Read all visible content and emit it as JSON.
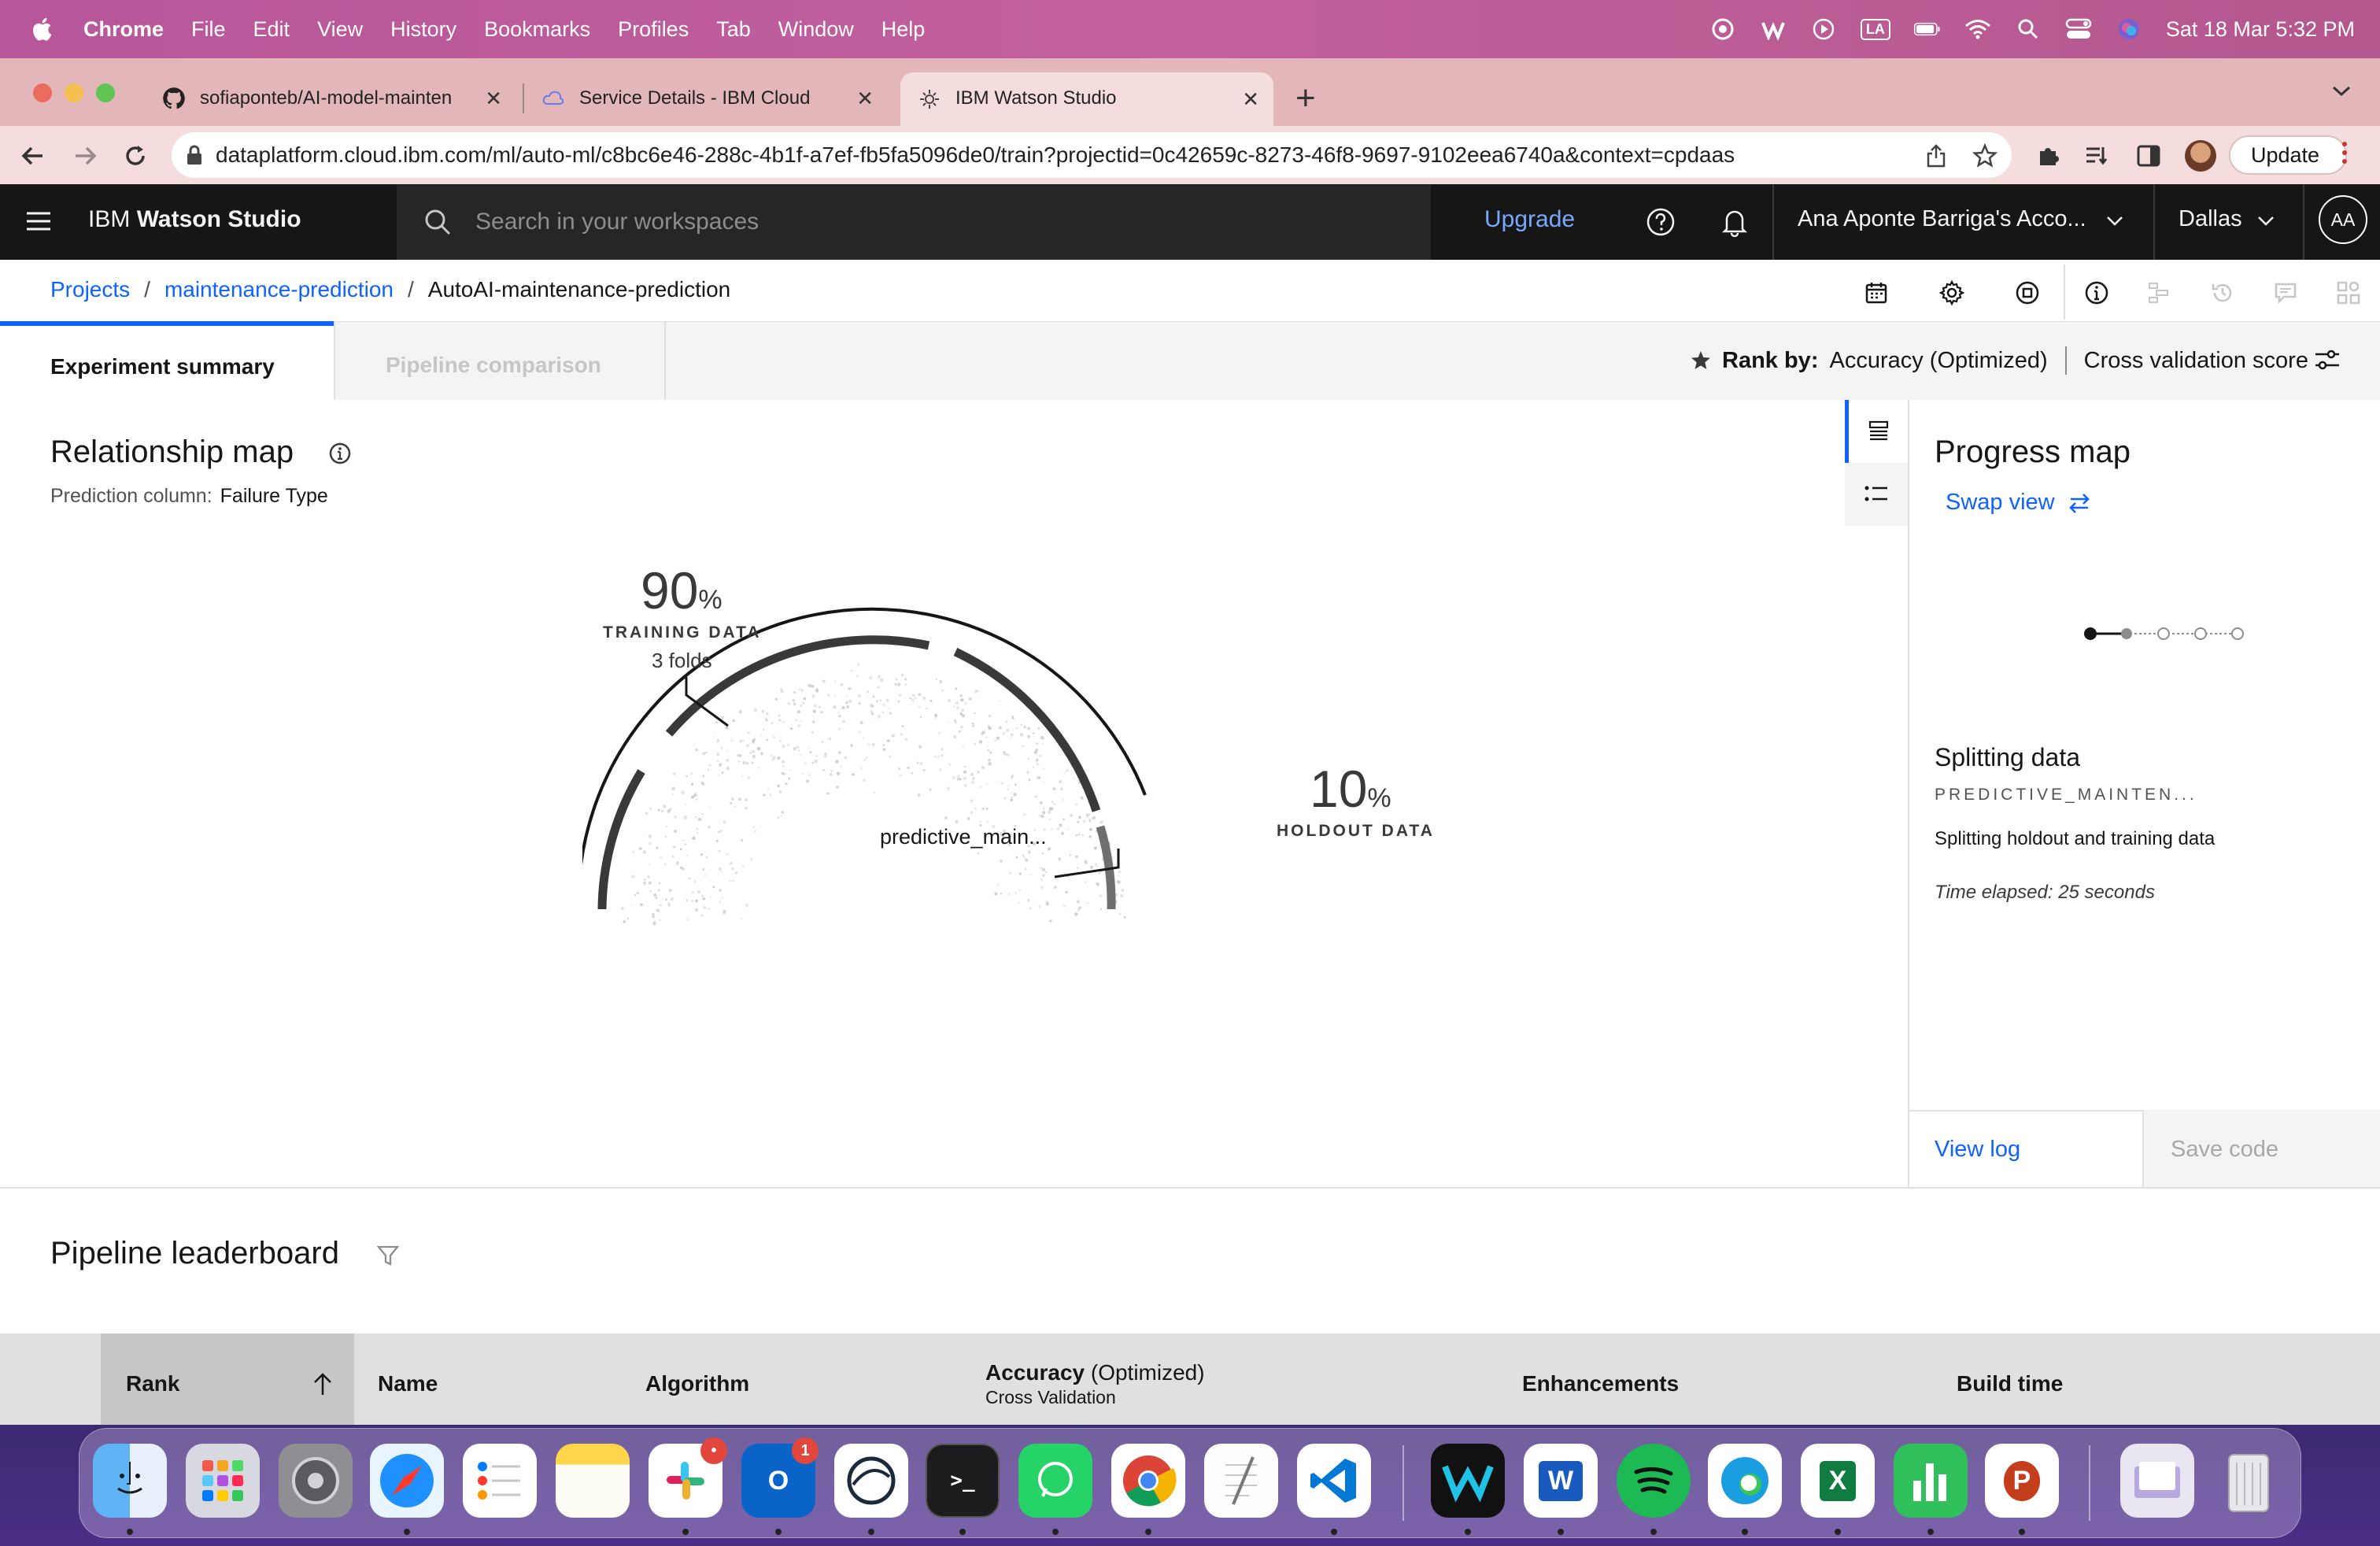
{
  "menubar": {
    "app": "Chrome",
    "items": [
      "File",
      "Edit",
      "View",
      "History",
      "Bookmarks",
      "Profiles",
      "Tab",
      "Window",
      "Help"
    ],
    "keyboard_layout": "LA",
    "datetime": "Sat 18 Mar  5:32 PM"
  },
  "browser": {
    "tabs": [
      {
        "title": "sofiaponteb/AI-model-mainten",
        "icon": "github-icon"
      },
      {
        "title": "Service Details - IBM Cloud",
        "icon": "ibm-cloud-icon"
      },
      {
        "title": "IBM Watson Studio",
        "icon": "watson-icon",
        "active": true
      }
    ],
    "url": "dataplatform.cloud.ibm.com/ml/auto-ml/c8bc6e46-288c-4b1f-a7ef-fb5fa5096de0/train?projectid=0c42659c-8273-46f8-9697-9102eea6740a&context=cpdaas",
    "update_label": "Update"
  },
  "ibm_header": {
    "brand_prefix": "IBM",
    "brand_name": "Watson Studio",
    "search_placeholder": "Search in your workspaces",
    "upgrade_label": "Upgrade",
    "account": "Ana Aponte Barriga's Acco...",
    "region": "Dallas",
    "avatar_initials": "AA"
  },
  "breadcrumb": {
    "projects": "Projects",
    "project": "maintenance-prediction",
    "experiment": "AutoAI-maintenance-prediction",
    "separator": "/"
  },
  "tabs": {
    "summary": "Experiment summary",
    "comparison": "Pipeline comparison"
  },
  "rank": {
    "label": "Rank by:",
    "metric": "Accuracy (Optimized)",
    "score": "Cross validation score"
  },
  "relationship_map": {
    "title": "Relationship map",
    "prediction_label": "Prediction column:",
    "prediction_value": "Failure Type",
    "training_pct": "90",
    "training_label": "TRAINING DATA",
    "folds": "3 folds",
    "holdout_pct": "10",
    "holdout_label": "HOLDOUT DATA",
    "pct_sign": "%",
    "center": "predictive_main..."
  },
  "progress_map": {
    "title": "Progress map",
    "swap_view": "Swap view",
    "step_title": "Splitting data",
    "dataset": "PREDICTIVE_MAINTEN...",
    "description": "Splitting holdout and training data",
    "time_elapsed": "Time elapsed: 25 seconds",
    "view_log": "View log",
    "save_code": "Save code"
  },
  "leaderboard": {
    "title": "Pipeline leaderboard",
    "columns": {
      "rank": "Rank",
      "name": "Name",
      "algorithm": "Algorithm",
      "accuracy": "Accuracy",
      "accuracy_qualifier": "(Optimized)",
      "accuracy_sub": "Cross Validation",
      "enhancements": "Enhancements",
      "build_time": "Build time"
    }
  },
  "dock": {
    "apps": [
      "Finder",
      "Launchpad",
      "System Preferences",
      "Safari",
      "Reminders",
      "Notes",
      "Slack",
      "Outlook",
      "Camo",
      "Terminal",
      "WhatsApp",
      "Chrome",
      "TextEdit",
      "VS Code",
      "Webex",
      "Word",
      "Spotify",
      "Edge",
      "Excel",
      "Numbers",
      "PowerPoint",
      "Downloads",
      "Trash"
    ],
    "badges": {
      "slack": "•",
      "outlook": "1"
    }
  }
}
